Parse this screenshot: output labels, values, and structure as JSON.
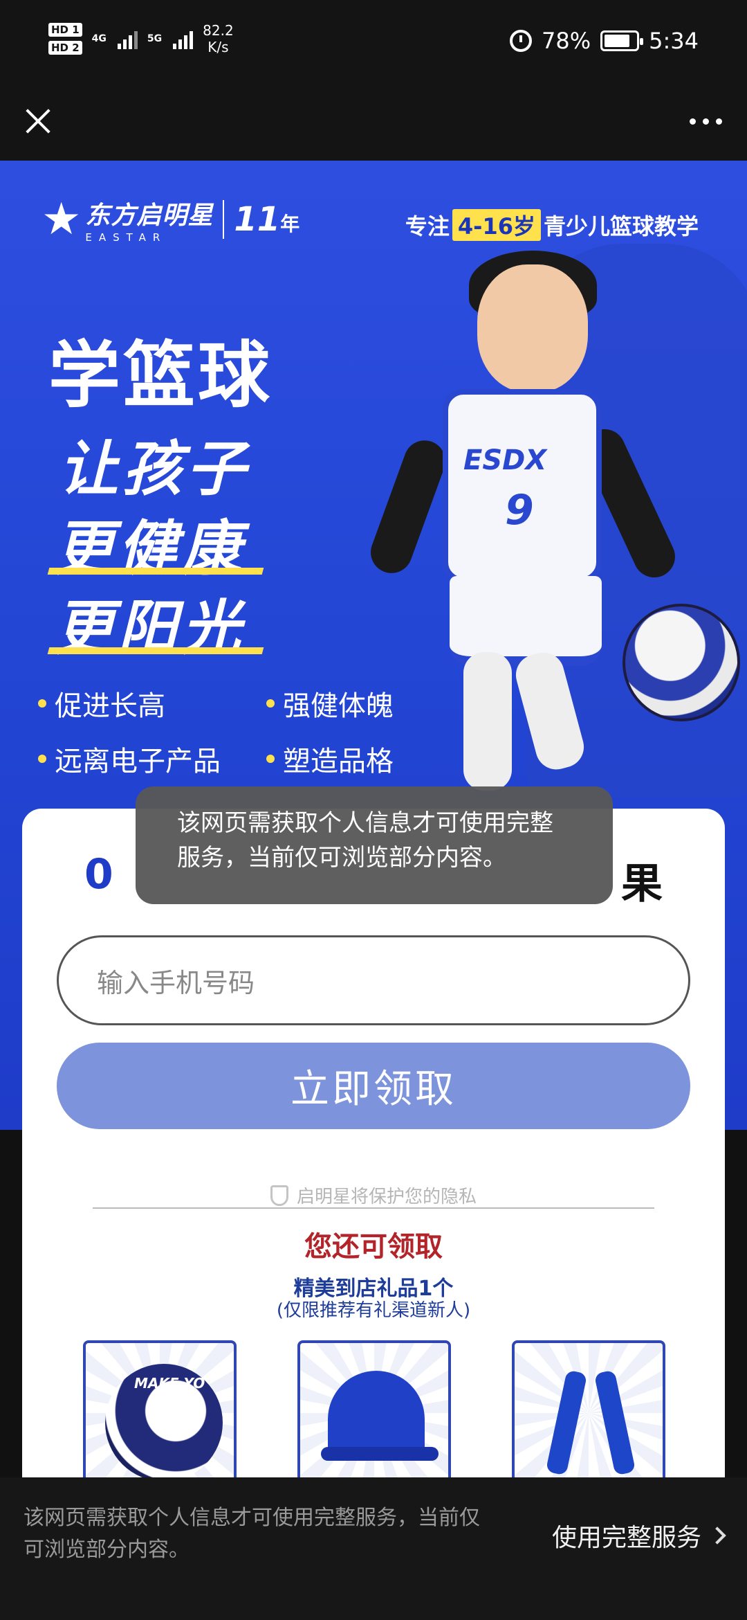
{
  "status_bar": {
    "hd1": "HD 1",
    "hd2": "HD 2",
    "net1": "4G",
    "net2": "5G",
    "speed_value": "82.2",
    "speed_unit": "K/s",
    "battery": "78%",
    "time": "5:34"
  },
  "nav": {
    "close_icon": "close-icon",
    "more_icon": "more-icon"
  },
  "hero": {
    "logo_cn": "东方启明星",
    "logo_en": "EASTAR",
    "logo_year": "11",
    "logo_year_suffix": "年",
    "tagline_pre": "专注",
    "tagline_highlight": "4-16岁",
    "tagline_post": "青少儿篮球教学",
    "headline_1": "学篮球",
    "headline_2": "让孩子",
    "headline_3": "更健康",
    "headline_4": "更阳光",
    "jersey_text": "ESDX",
    "jersey_number": "9",
    "bullets": [
      "促进长高",
      "强健体魄",
      "远离电子产品",
      "塑造品格"
    ]
  },
  "card": {
    "title_left": "0",
    "title_right": "果",
    "phone_placeholder": "输入手机号码",
    "submit_label": "立即领取",
    "privacy_text": "启明星将保护您的隐私",
    "more_title": "您还可领取",
    "gift_line": "精美到店礼品1个",
    "gift_note": "(仅限推荐有礼渠道新人)",
    "gifts": [
      "basketball",
      "cap",
      "jump-rope"
    ],
    "ball_text": "MAKE YO"
  },
  "toast": {
    "text": "该网页需获取个人信息才可使用完整服务，当前仅可浏览部分内容。"
  },
  "bottom_bar": {
    "message": "该网页需获取个人信息才可使用完整服务，当前仅可浏览部分内容。",
    "cta": "使用完整服务"
  },
  "colors": {
    "brand_blue": "#1e3cc8",
    "highlight_yellow": "#ffe04d",
    "button_blue": "#7d93dc",
    "accent_red": "#b3242a"
  }
}
